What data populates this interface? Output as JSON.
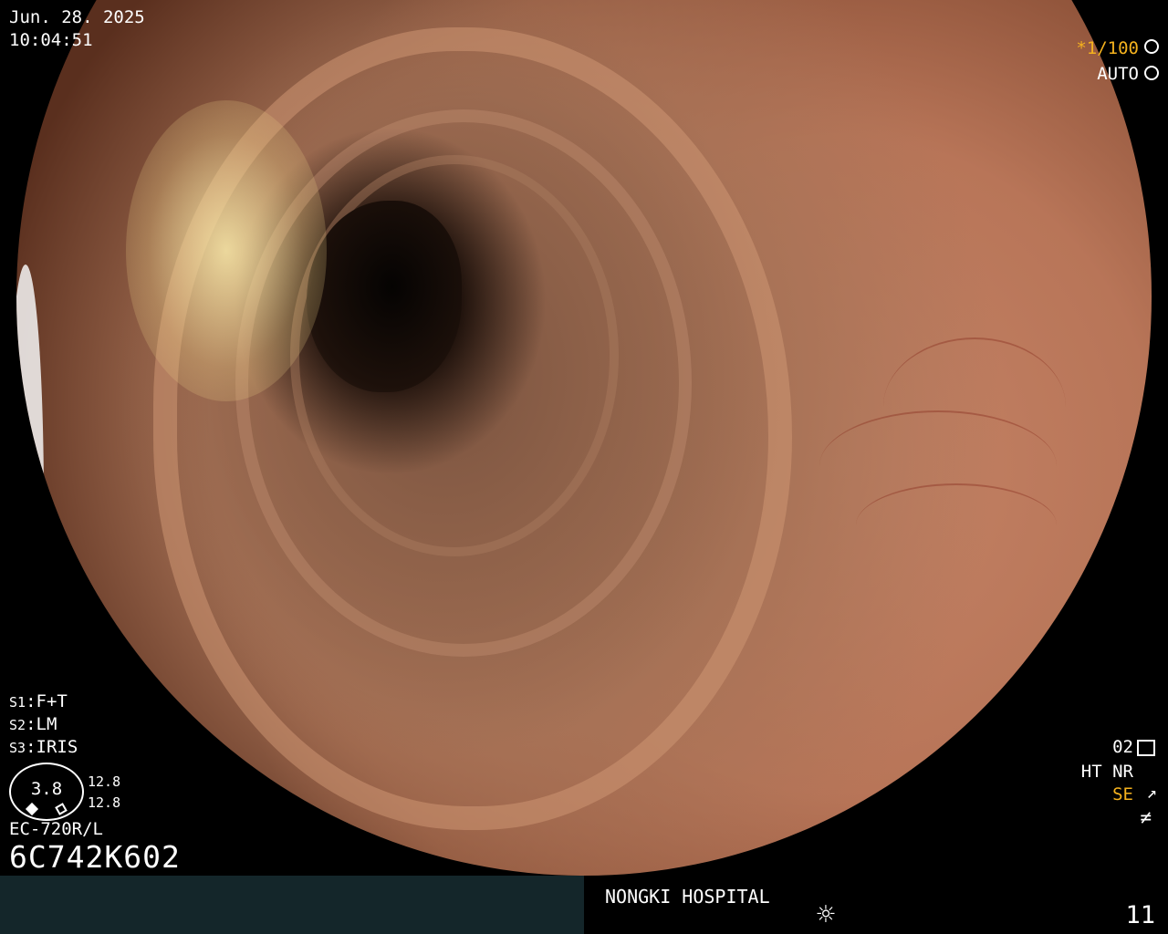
{
  "header": {
    "date": "Jun. 28. 2025",
    "time": "10:04:51"
  },
  "top_right": {
    "shutter": "*1/100",
    "mode": "AUTO"
  },
  "settings": {
    "s1": {
      "key": "S1",
      "value": "F+T"
    },
    "s2": {
      "key": "S2",
      "value": "LM"
    },
    "s3": {
      "key": "S3",
      "value": "IRIS"
    }
  },
  "gauge": {
    "value": "3.8",
    "top_reading": "12.8",
    "bottom_reading": "12.8"
  },
  "scope": {
    "model": "EC-720R/L",
    "serial": "6C742K602"
  },
  "bottom_right": {
    "code": "02",
    "ht_nr": "HT NR",
    "se": "SE",
    "se_icon": "⫘"
  },
  "footer": {
    "hospital": "NONGKI HOSPITAL",
    "frame_number": "11"
  },
  "icons": {
    "shutter": "shutter-icon",
    "auto": "auto-iris-icon",
    "sun": "sun-icon",
    "settings": "sliders-icon"
  },
  "colors": {
    "accent_orange": "#f5b21e",
    "bar_left": "#14262a"
  }
}
